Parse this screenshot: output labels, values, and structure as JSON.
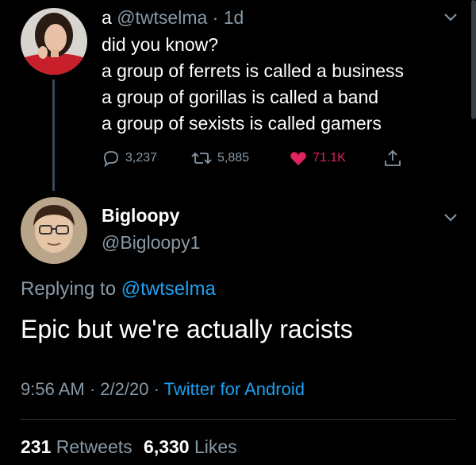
{
  "original_tweet": {
    "display_name": "a",
    "handle": "@twtselma",
    "separator": "·",
    "time": "1d",
    "lines": [
      "did you know?",
      "a group of ferrets is called a business",
      "a group of gorillas is called a band",
      "a group of sexists is called gamers"
    ],
    "replies": "3,237",
    "retweets": "5,885",
    "likes": "71.1K",
    "like_color": "#e0245e"
  },
  "reply_tweet": {
    "display_name": "Bigloopy",
    "handle": "@Bigloopy1",
    "replying_prefix": "Replying to",
    "replying_to": "@twtselma",
    "text": "Epic but we're actually racists",
    "time": "9:56 AM",
    "date": "2/2/20",
    "sep1": "·",
    "sep2": "·",
    "client": "Twitter for Android",
    "retweet_count": "231",
    "retweet_label": "Retweets",
    "like_count": "6,330",
    "like_label": "Likes"
  },
  "colors": {
    "background": "#000000",
    "muted": "#8899a6",
    "link": "#1da1f2"
  }
}
